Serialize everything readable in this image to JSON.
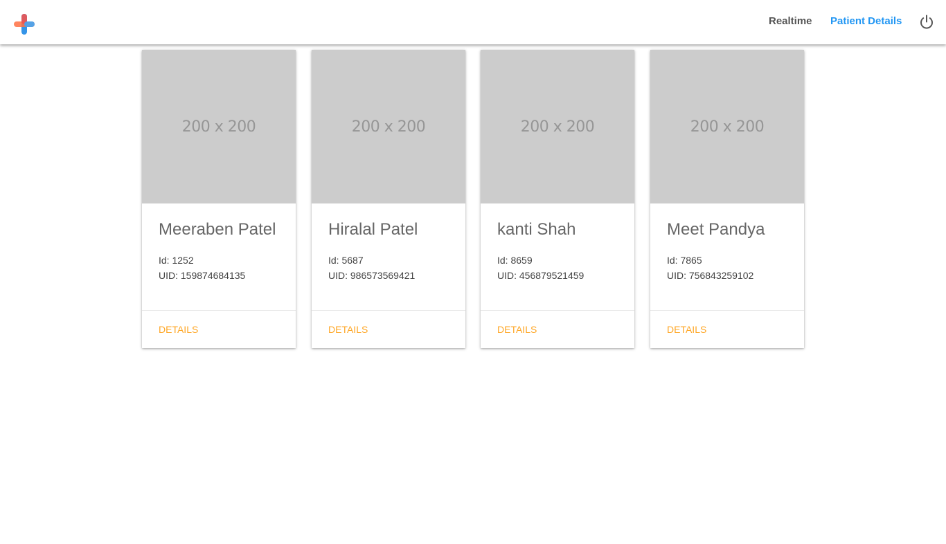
{
  "header": {
    "logo_icon": "plus-logo-icon",
    "nav": {
      "realtime_label": "Realtime",
      "patient_details_label": "Patient Details"
    },
    "power_icon": "power-icon",
    "colors": {
      "active_link": "#2196f3",
      "inactive_link": "#555555"
    }
  },
  "patients": [
    {
      "image_placeholder": "200 x 200",
      "name": "Meeraben Patel",
      "id_text": "Id: 1252",
      "uid_text": "UID: 159874684135",
      "action_label": "DETAILS"
    },
    {
      "image_placeholder": "200 x 200",
      "name": "Hiralal Patel",
      "id_text": "Id: 5687",
      "uid_text": "UID: 986573569421",
      "action_label": "DETAILS"
    },
    {
      "image_placeholder": "200 x 200",
      "name": "kanti Shah",
      "id_text": "Id: 8659",
      "uid_text": "UID: 456879521459",
      "action_label": "DETAILS"
    },
    {
      "image_placeholder": "200 x 200",
      "name": "Meet Pandya",
      "id_text": "Id: 7865",
      "uid_text": "UID: 756843259102",
      "action_label": "DETAILS"
    }
  ],
  "colors": {
    "action": "#ffa726",
    "image_placeholder_bg": "#cccccc"
  }
}
